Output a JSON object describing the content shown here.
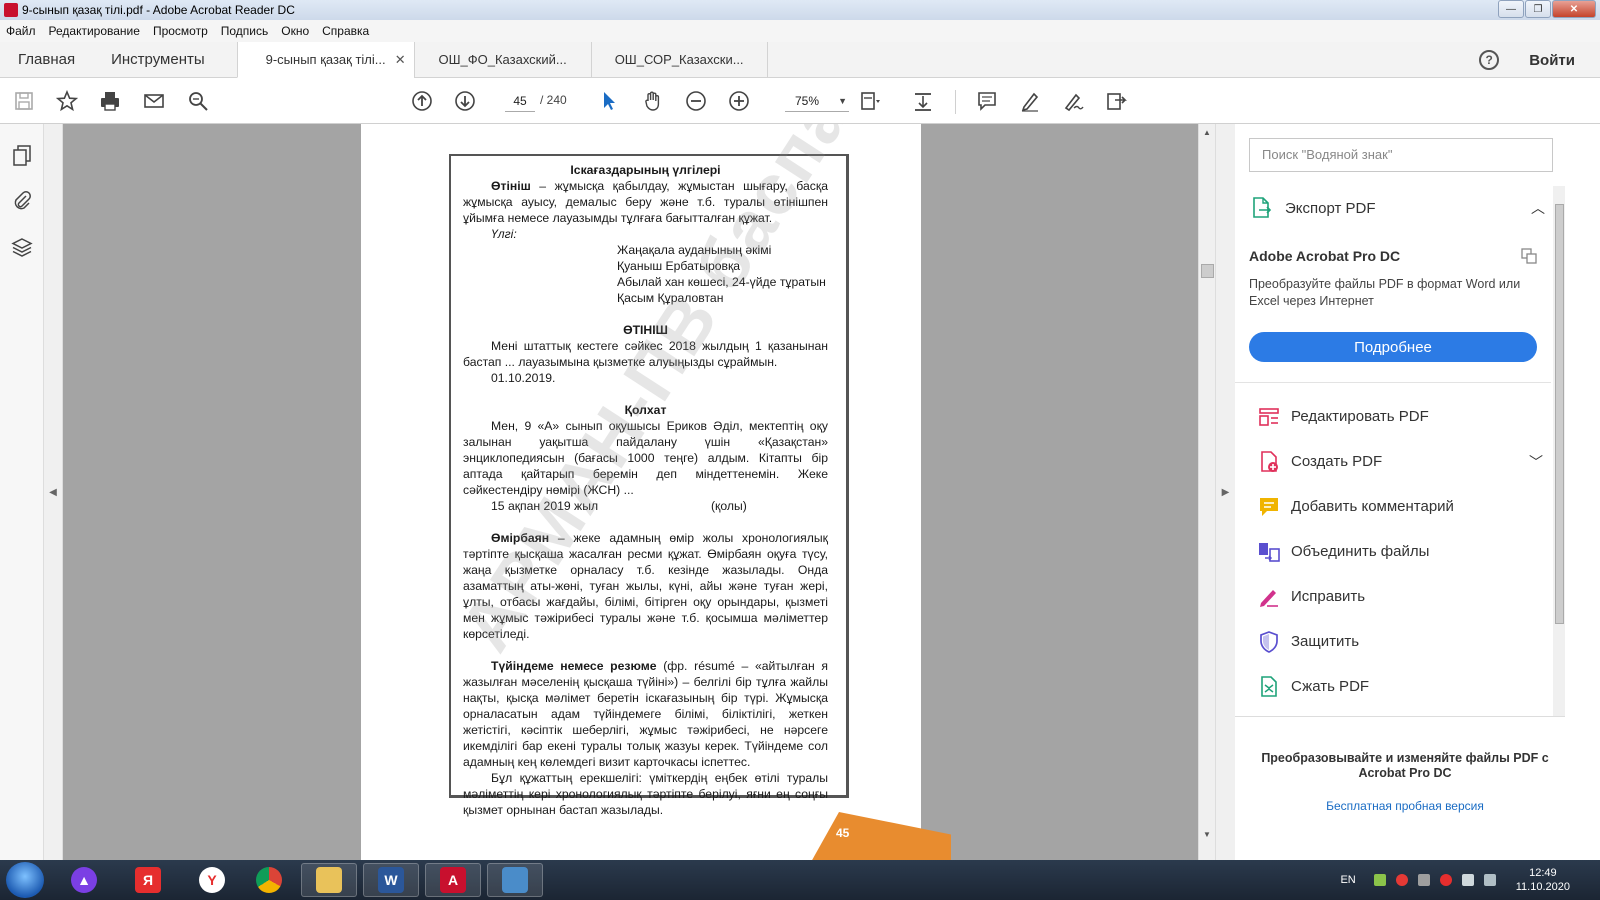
{
  "window": {
    "title": "9-сынып қазақ тілі.pdf - Adobe Acrobat Reader DC",
    "accent_color": "#c8102e"
  },
  "menu": [
    "Файл",
    "Редактирование",
    "Просмотр",
    "Подпись",
    "Окно",
    "Справка"
  ],
  "tabs": {
    "home": "Главная",
    "tools": "Инструменты",
    "docs": [
      {
        "label": "9-сынып қазақ тілі...",
        "active": true,
        "close": "✕"
      },
      {
        "label": "ОШ_ФО_Казахский...",
        "active": false
      },
      {
        "label": "ОШ_СОР_Казахски...",
        "active": false
      }
    ],
    "help": "?",
    "signin": "Войти"
  },
  "toolbar": {
    "page_current": "45",
    "page_total": "/   240",
    "zoom": "75%"
  },
  "document": {
    "title": "Іскағаздарының үлгілері",
    "p1_term": "Өтініш",
    "p1_rest": " – жұмысқа қабылдау, жұмыстан шығару, басқа жұмысқа ауысу, демалыс беру және т.б. туралы өтінішпен ұйымға немесе лауазымды тұлғаға бағытталған құжат.",
    "sample_label": "Үлгі:",
    "addr1": "Жаңақала ауданының әкімі",
    "addr2": "Қуаныш Ербатыровқа",
    "addr3": "Абылай хан көшесі, 24-үйде тұратын",
    "addr4": "Қасым Құраловтан",
    "heading2": "ӨТІНІШ",
    "p2": "Мені штаттық кестеге сәйкес 2018 жылдың 1 қазанынан бастап ... лауазымына қызметке алуыңызды сұраймын.",
    "date1": "01.10.2019.",
    "heading3": "Қолхат",
    "p3": "Мен, 9 «А» сынып оқушысы Ериков Әділ, мектептің оқу залынан уақытша пайдалану үшін «Қазақстан» энциклопедиясын (бағасы 1000 теңге) алдым. Кітапты бір аптада қайтарып беремін деп міндеттенемін. Жеке сәйкестендіру нөмірі (ЖСН) ...",
    "date2": "15 ақпан 2019 жыл",
    "signature": "(қолы)",
    "p4_term": "Өмірбаян",
    "p4_rest": " – жеке адамның өмір жолы хронологиялық тәртіпте қысқаша жасалған ресми құжат. Өмірбаян оқуға түсу, жаңа қызметке орналасу т.б. кезінде жазылады. Онда азаматтың аты-жөні, туған жылы, күні, айы және туған жері, ұлты, отбасы жағдайы, білімі, бітірген оқу орындары, қызметі мен жұмыс тәжірибесі туралы және т.б. қосымша мәліметтер көрсетіледі.",
    "p5_term": "Түйіндеме немесе резюме",
    "p5_rest": " (фр. résumé – «айтылған я жазылған мәселенің қысқаша түйіні») – белгілі бір тұлға жайлы нақты, қысқа мәлімет беретін іскағазының бір түрі. Жұмысқа орналасатын адам түйіндемеге білімі, біліктілігі, жеткен жетістігі, кәсіптік шеберлігі, жұмыс тәжірибесі, не нәрсеге икемділігі бар екені туралы толық жазуы керек. Түйіндеме сол адамның кең көлемдегі визит карточкасы іспеттес.",
    "p6": "Бұл құжаттың ерекшелігі: үміткердің еңбек өтілі туралы мәліметтің кері хронологиялық тәртіпте берілуі, яғни ең соңғы қызмет орнынан бастап жазылады.",
    "watermark": "АРМАН-ПВ баспасы",
    "page_number": "45",
    "page_tab_color": "#e88c2f"
  },
  "right_pane": {
    "search_placeholder": "Поиск \"Водяной знак\"",
    "export_label": "Экспорт PDF",
    "pro_title": "Adobe Acrobat Pro DC",
    "pro_desc": "Преобразуйте файлы PDF в формат Word или Excel через Интернет",
    "more_button": "Подробнее",
    "button_color": "#2c7be5",
    "tools": [
      {
        "label": "Редактировать PDF",
        "icon": "edit-pdf-icon",
        "color": "#e0315b"
      },
      {
        "label": "Создать PDF",
        "icon": "create-pdf-icon",
        "color": "#e0315b",
        "expand": true
      },
      {
        "label": "Добавить комментарий",
        "icon": "comment-icon",
        "color": "#f0b400"
      },
      {
        "label": "Объединить файлы",
        "icon": "combine-icon",
        "color": "#5a4fcf"
      },
      {
        "label": "Исправить",
        "icon": "fill-sign-icon",
        "color": "#d1328c"
      },
      {
        "label": "Защитить",
        "icon": "protect-icon",
        "color": "#5a4fcf"
      },
      {
        "label": "Сжать PDF",
        "icon": "compress-icon",
        "color": "#1fa37a"
      }
    ],
    "promo_text": "Преобразовывайте и изменяйте файлы PDF с Acrobat Pro DC",
    "promo_link": "Бесплатная пробная версия"
  },
  "taskbar": {
    "lang": "EN",
    "time": "12:49",
    "date": "11.10.2020"
  }
}
